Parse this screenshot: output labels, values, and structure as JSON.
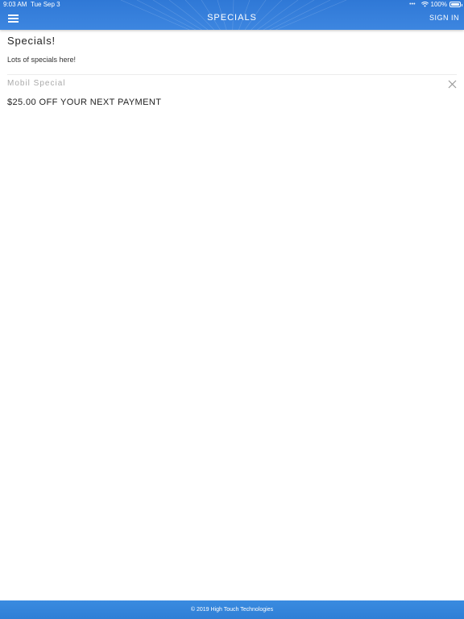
{
  "status_bar": {
    "time": "9:03 AM",
    "date": "Tue Sep 3",
    "battery": "100%"
  },
  "header": {
    "title": "SPECIALS",
    "sign_in": "SIGN IN",
    "menu_icon": "hamburger-menu-icon"
  },
  "page": {
    "title": "Specials!",
    "subtitle": "Lots of specials here!"
  },
  "special": {
    "title": "Mobil Special",
    "body": "$25.00 OFF YOUR NEXT PAYMENT",
    "close_icon": "close-icon"
  },
  "footer": {
    "text": "© 2019 High Touch Technologies"
  },
  "colors": {
    "header_blue": "#2f78d6",
    "footer_blue": "#3a8be0",
    "muted_text": "#a9a9a9"
  }
}
